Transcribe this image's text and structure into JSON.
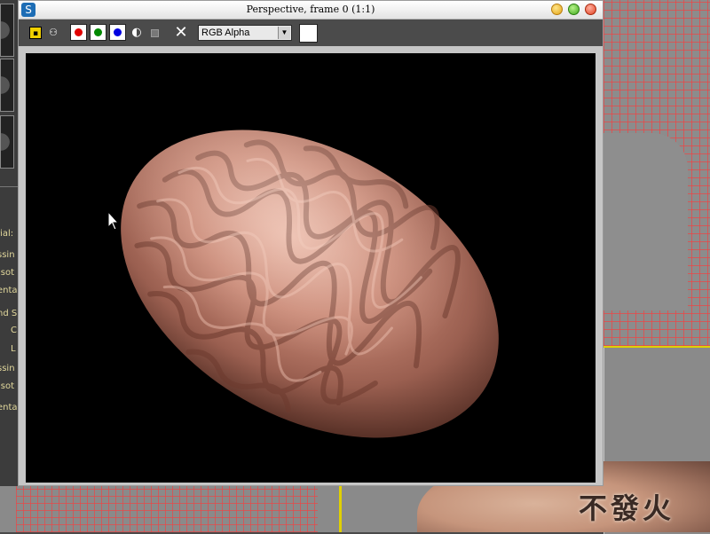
{
  "window": {
    "title": "Perspective, frame 0 (1:1)",
    "controls": {
      "minimize": "minimize",
      "maximize": "maximize",
      "close": "close"
    }
  },
  "toolbar": {
    "icons": [
      "save-icon",
      "clone-icon",
      "mono-icon",
      "alpha-icon",
      "clear-icon"
    ],
    "channels": {
      "red": "#e00000",
      "green": "#008800",
      "blue": "#0000e0"
    },
    "channel_display": "RGB Alpha"
  },
  "left_panel": {
    "labels": [
      "rial:",
      "ssin",
      "isot",
      "enta",
      "nd S",
      "C",
      "L",
      "ssin",
      "isot",
      "enta"
    ]
  },
  "watermark": "不發火",
  "colors": {
    "toolbar_bg": "#4b4b4b",
    "window_bg": "#c6c6c6",
    "render_bg": "#000000",
    "brain_base": "#c4826d",
    "wireframe": "#eb4646",
    "viewport_border_active": "#e0d000"
  }
}
